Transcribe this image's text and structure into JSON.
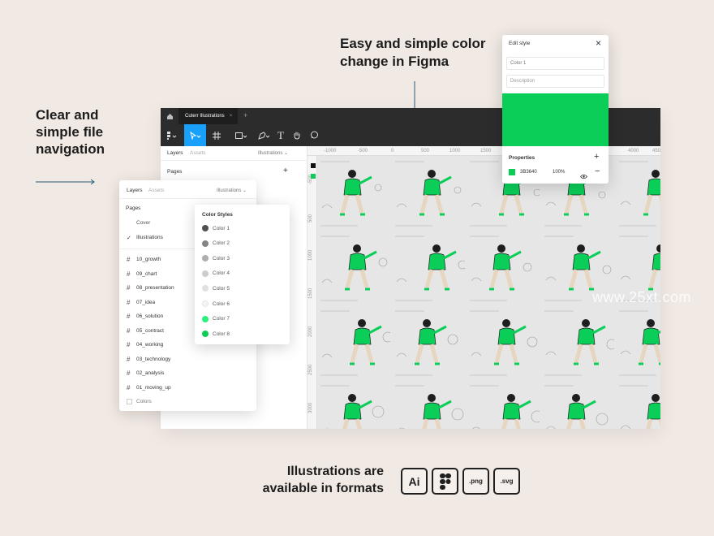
{
  "captions": {
    "left_line1": "Clear and",
    "left_line2": "simple file",
    "left_line3": "navigation",
    "top_line1": "Easy and simple color",
    "top_line2": "change in Figma",
    "bottom_line1": "Illustrations are",
    "bottom_line2": "available in formats"
  },
  "watermark": "www.25xt.com",
  "tab": {
    "title": "Cuterr Illustrations",
    "close": "×",
    "add": "+"
  },
  "left_panel": {
    "tab_layers": "Layers",
    "tab_assets": "Assets",
    "dropdown": "Illustrations",
    "pages_label": "Pages",
    "add": "+"
  },
  "ruler_top": [
    "-1000",
    "-500",
    "0",
    "500",
    "1000",
    "1500",
    "2000",
    "4000",
    "4500"
  ],
  "ruler_left": [
    "-500",
    "500",
    "1000",
    "1500",
    "2000",
    "2500",
    "3000"
  ],
  "layers_panel": {
    "tab_layers": "Layers",
    "tab_assets": "Assets",
    "dropdown": "Illustrations ⌄",
    "pages_label": "Pages",
    "pages": [
      "Cover",
      "Illustrations"
    ],
    "checkmark": "✓",
    "frames": [
      "10_growth",
      "09_chart",
      "08_presentation",
      "07_idea",
      "06_solution",
      "05_contract",
      "04_working",
      "03_technology",
      "02_analysis",
      "01_moving_up"
    ],
    "colors_label": "Colors"
  },
  "color_styles": {
    "title": "Color Styles",
    "items": [
      {
        "label": "Color 1",
        "color": "#505050"
      },
      {
        "label": "Color 2",
        "color": "#858585"
      },
      {
        "label": "Color 3",
        "color": "#aeaeae"
      },
      {
        "label": "Color 4",
        "color": "#cdcdcd"
      },
      {
        "label": "Color 5",
        "color": "#e1e1e1"
      },
      {
        "label": "Color 6",
        "color": "#f5f5f5"
      },
      {
        "label": "Color 7",
        "color": "#2bf07a"
      },
      {
        "label": "Color 8",
        "color": "#0dce55"
      }
    ]
  },
  "edit_style": {
    "title": "Edit style",
    "close": "×",
    "name_value": "Color 1",
    "description_placeholder": "Description",
    "preview_color": "#0ace58",
    "properties_label": "Properties",
    "add": "+",
    "hex": "3B3640",
    "opacity": "100%",
    "remove": "−"
  },
  "formats": [
    "Ai",
    "Fig",
    ".png",
    ".svg"
  ],
  "colors": {
    "accent_green": "#0ace58",
    "figma_blue": "#18a0fb",
    "dark_bar": "#2c2c2c",
    "arrow": "#2a5a7a"
  }
}
